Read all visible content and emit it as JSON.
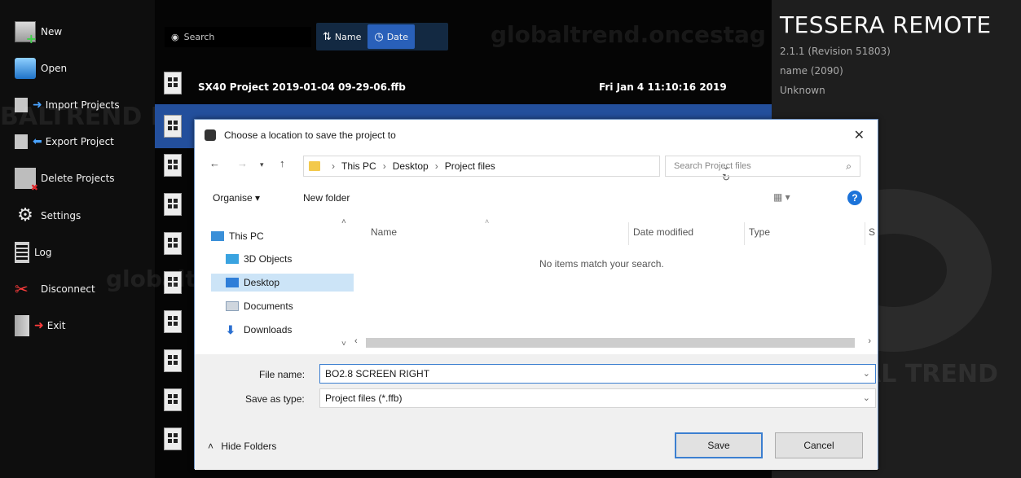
{
  "sidebar": {
    "items": [
      {
        "label": "New",
        "icon": "new-icon"
      },
      {
        "label": "Open",
        "icon": "open-icon"
      },
      {
        "label": "Import Projects",
        "icon": "import-icon"
      },
      {
        "label": "Export Project",
        "icon": "export-icon"
      },
      {
        "label": "Delete Projects",
        "icon": "delete-icon"
      },
      {
        "label": "Settings",
        "icon": "gear-icon"
      },
      {
        "label": "Log",
        "icon": "log-icon"
      },
      {
        "label": "Disconnect",
        "icon": "disconnect-icon"
      },
      {
        "label": "Exit",
        "icon": "exit-icon"
      }
    ]
  },
  "main": {
    "search_placeholder": "Search",
    "sort_name_label": "Name",
    "sort_date_label": "Date",
    "rows": [
      {
        "name": "SX40 Project 2019-01-04 09-29-06.ffb",
        "date": "Fri Jan 4 11:10:16 2019"
      }
    ]
  },
  "info": {
    "title": "TESSERA REMOTE",
    "version": "2.1.1 (Revision 51803)",
    "name": "name (2090)",
    "status": "Unknown"
  },
  "watermarks": {
    "top": "globaltrend.oncestag",
    "middle": "globaltrend.oncestaging.com",
    "left": "BALTREND PRO",
    "right": "GLOBAL TREND"
  },
  "dialog": {
    "title": "Choose a location to save the project to",
    "breadcrumbs": [
      "This PC",
      "Desktop",
      "Project files"
    ],
    "search_placeholder": "Search Project files",
    "organise_label": "Organise ▾",
    "new_folder_label": "New folder",
    "help_label": "?",
    "tree": [
      {
        "label": "This PC",
        "icon": "pc-icon",
        "selected": false
      },
      {
        "label": "3D Objects",
        "icon": "3d-objects-icon",
        "selected": false
      },
      {
        "label": "Desktop",
        "icon": "desktop-icon",
        "selected": true
      },
      {
        "label": "Documents",
        "icon": "documents-icon",
        "selected": false
      },
      {
        "label": "Downloads",
        "icon": "downloads-icon",
        "selected": false
      }
    ],
    "columns": [
      "Name",
      "Date modified",
      "Type",
      "S"
    ],
    "empty_message": "No items match your search.",
    "file_name_label": "File name:",
    "file_name_value": "BO2.8 SCREEN RIGHT",
    "save_type_label": "Save as type:",
    "save_type_value": "Project files (*.ffb)",
    "hide_folders_label": "Hide Folders",
    "save_label": "Save",
    "cancel_label": "Cancel"
  }
}
